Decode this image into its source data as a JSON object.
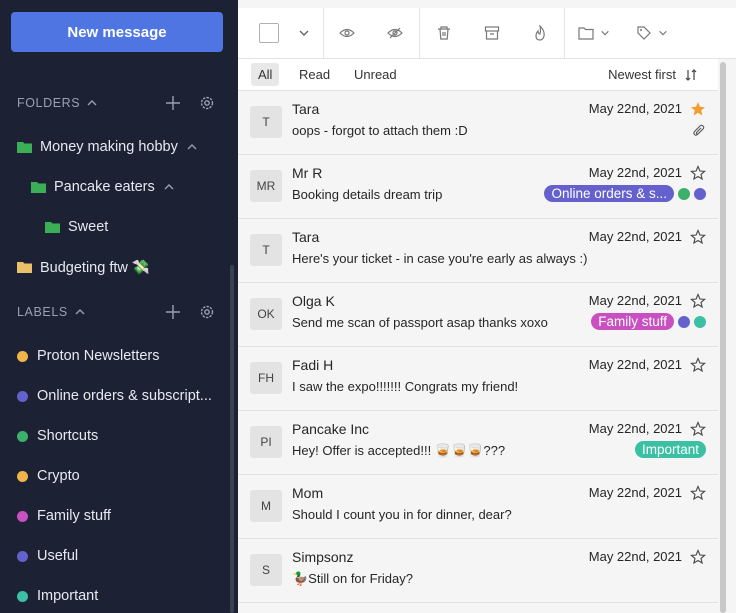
{
  "new_message_label": "New message",
  "folders": {
    "heading": "FOLDERS",
    "items": [
      {
        "label": "Money making hobby",
        "color": "#3aaf55"
      },
      {
        "label": "Pancake eaters",
        "color": "#3aaf55"
      },
      {
        "label": "Sweet",
        "color": "#3aaf55"
      },
      {
        "label": "Budgeting ftw 💸",
        "color": "#e8c16a"
      }
    ]
  },
  "labels": {
    "heading": "LABELS",
    "items": [
      {
        "label": "Proton Newsletters",
        "color": "#f0b44a"
      },
      {
        "label": "Online orders & subscript...",
        "color": "#6461cc"
      },
      {
        "label": "Shortcuts",
        "color": "#3db06b"
      },
      {
        "label": "Crypto",
        "color": "#f0b44a"
      },
      {
        "label": "Family stuff",
        "color": "#c850c0"
      },
      {
        "label": "Useful",
        "color": "#6461cc"
      },
      {
        "label": "Important",
        "color": "#3bc0a4"
      }
    ]
  },
  "toolbar": {
    "icons": [
      "eye-icon",
      "eye-slash-icon",
      "trash-icon",
      "archive-icon",
      "fire-icon",
      "folder-icon",
      "tag-icon"
    ]
  },
  "filter": {
    "tabs": [
      "All",
      "Read",
      "Unread"
    ],
    "active": "All",
    "sort": "Newest first"
  },
  "messages": [
    {
      "initials": "T",
      "sender": "Tara",
      "subject": "oops - forgot to attach them :D",
      "date": "May 22nd, 2021",
      "starred": true,
      "attachment": true
    },
    {
      "initials": "MR",
      "sender": "Mr R",
      "subject": "Booking details dream trip",
      "date": "May 22nd, 2021",
      "starred": false,
      "label": "Online orders & s...",
      "label_color": "#6461cc",
      "dots": [
        "#3db06b",
        "#6461cc"
      ]
    },
    {
      "initials": "T",
      "sender": "Tara",
      "subject": "Here's your ticket - in case you're early as always :)",
      "date": "May 22nd, 2021",
      "starred": false
    },
    {
      "initials": "OK",
      "sender": "Olga K",
      "subject": "Send me scan of passport asap thanks xoxo",
      "date": "May 22nd, 2021",
      "starred": false,
      "label": "Family stuff",
      "label_color": "#c850c0",
      "dots": [
        "#6461cc",
        "#3bc0a4"
      ]
    },
    {
      "initials": "FH",
      "sender": "Fadi H",
      "subject": "I saw the expo!!!!!!! Congrats my friend!",
      "date": "May 22nd, 2021",
      "starred": false
    },
    {
      "initials": "PI",
      "sender": "Pancake Inc",
      "subject": "Hey! Offer is accepted!!! 🥃🥃🥃???",
      "date": "May 22nd, 2021",
      "starred": false,
      "label": "Important",
      "label_color": "#3bc0a4"
    },
    {
      "initials": "M",
      "sender": "Mom",
      "subject": "Should I count you in for dinner, dear?",
      "date": "May 22nd, 2021",
      "starred": false
    },
    {
      "initials": "S",
      "sender": "Simpsonz",
      "subject": "🦆Still on for Friday?",
      "date": "May 22nd, 2021",
      "starred": false
    }
  ]
}
